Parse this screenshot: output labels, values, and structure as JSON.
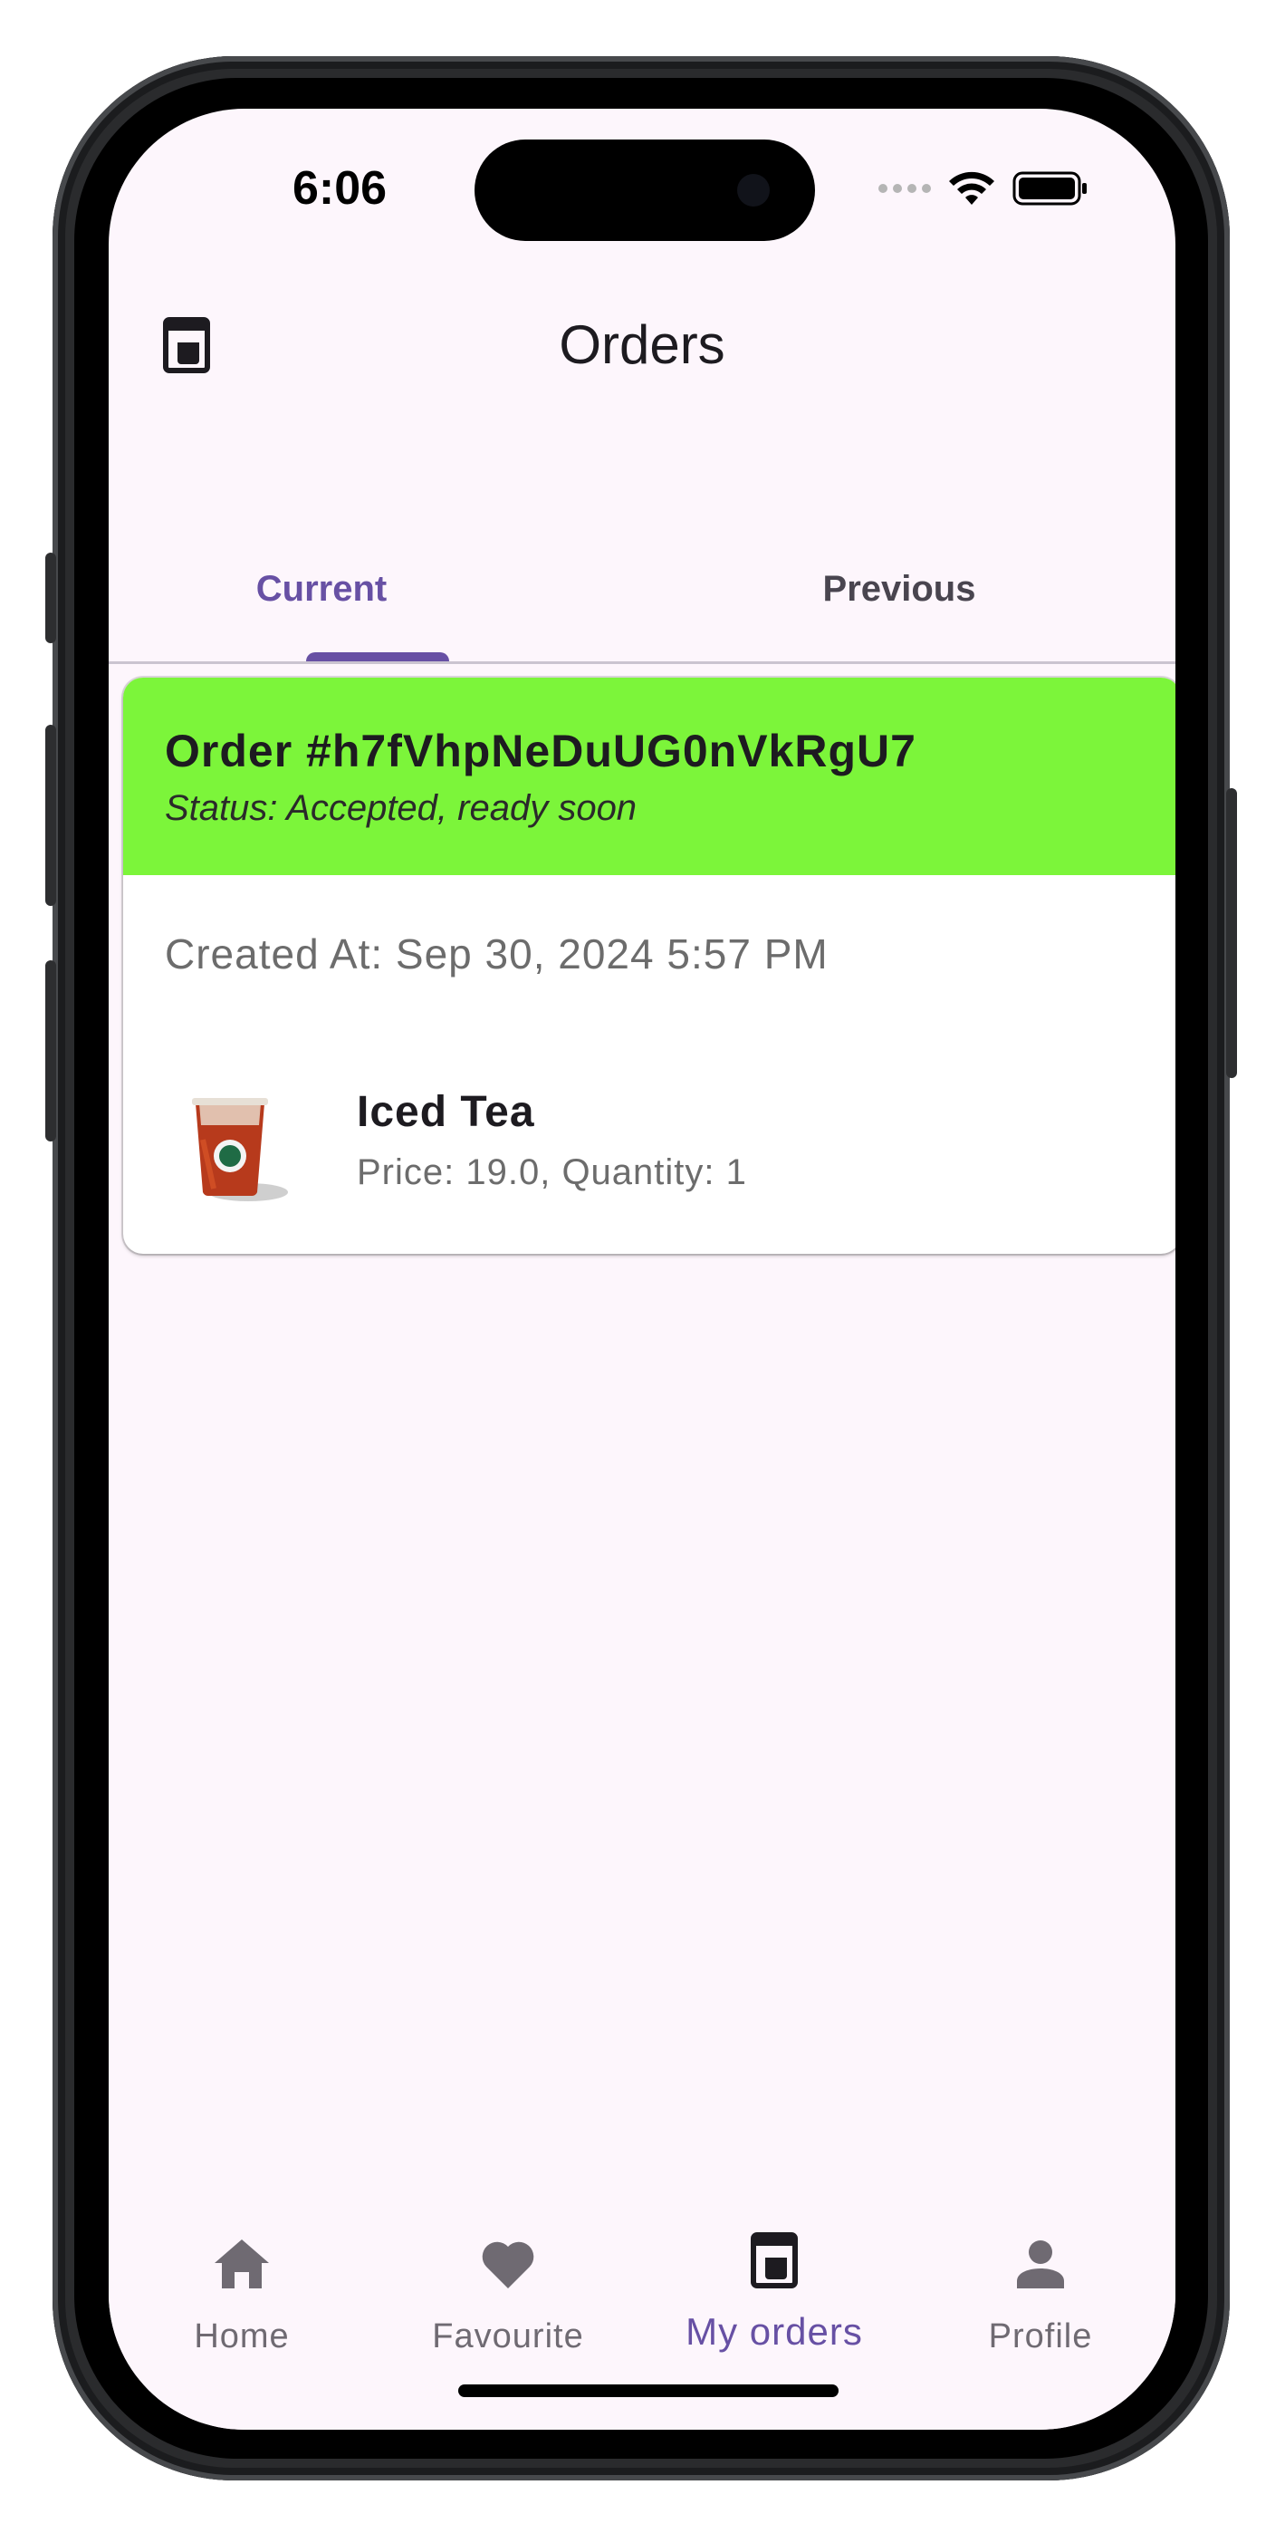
{
  "status_bar": {
    "time": "6:06",
    "icons": [
      "signal-dots-icon",
      "wifi-icon",
      "battery-icon"
    ]
  },
  "app_bar": {
    "title": "Orders",
    "leading_icon": "coffee-machine-icon"
  },
  "tabs": [
    {
      "label": "Current",
      "selected": true
    },
    {
      "label": "Previous",
      "selected": false
    }
  ],
  "order": {
    "title": "Order #h7fVhpNeDuUG0nVkRgU7",
    "status": "Status: Accepted, ready soon",
    "created_at": "Created At: Sep 30, 2024 5:57 PM",
    "header_color": "#7CF53A",
    "items": [
      {
        "name": "Iced Tea",
        "detail": "Price: 19.0, Quantity: 1",
        "image": "iced-tea-cup"
      }
    ]
  },
  "bottom_nav": {
    "items": [
      {
        "label": "Home",
        "icon": "home-icon",
        "active": false
      },
      {
        "label": "Favourite",
        "icon": "heart-icon",
        "active": false
      },
      {
        "label": "My orders",
        "icon": "coffee-machine-icon",
        "active": true
      },
      {
        "label": "Profile",
        "icon": "person-icon",
        "active": false
      }
    ]
  },
  "colors": {
    "accent": "#6750A4",
    "background": "#FDF6FC",
    "muted_text": "#6C6C6C"
  }
}
